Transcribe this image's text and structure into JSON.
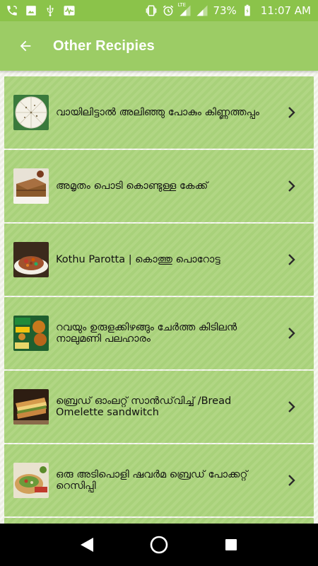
{
  "status_bar": {
    "battery_percent": "73%",
    "time": "11:07 AM",
    "network_label": "LTE",
    "icons": [
      "phone-call-icon",
      "image-icon",
      "usb-icon",
      "activity-icon",
      "vibrate-icon",
      "alarm-icon",
      "signal-icon",
      "signal-icon",
      "battery-icon"
    ]
  },
  "app_bar": {
    "title": "Other Recipies",
    "back_icon": "arrow-back-icon"
  },
  "theme": {
    "status_bar_color": "#8bc34a",
    "app_bar_color": "#9ccc65",
    "card_color": "#a8d17a"
  },
  "recipes": [
    {
      "title": "വായിലിട്ടാൽ അലിഞ്ഞു പോകും കിണ്ണത്തപ്പം",
      "thumb": "kinnathappam-thumbnail"
    },
    {
      "title": "അമൃതം പൊടി കൊണ്ടുള്ള കേക്ക്",
      "thumb": "cake-thumbnail"
    },
    {
      "title": "Kothu Parotta | കൊത്തു പൊറോട്ട",
      "thumb": "kothu-parotta-thumbnail"
    },
    {
      "title": "റവയും ഉരുളക്കിഴങ്ങും ചേർത്ത കിടിലൻ നാലുമണി പലഹാരം",
      "thumb": "rava-snack-thumbnail"
    },
    {
      "title": "ബ്രെഡ് ഓംലറ്റ് സാൻഡ്‌വിച്ച് /Bread Omelette sandwitch",
      "thumb": "sandwich-thumbnail"
    },
    {
      "title": "ഒരു അടിപൊളി ഷവർമ ബ്രെഡ് പോക്കറ്റ് റെസിപ്പി",
      "thumb": "shawarma-pocket-thumbnail"
    }
  ],
  "nav_bar": {
    "buttons": [
      "back-triangle-icon",
      "home-circle-icon",
      "recents-square-icon"
    ]
  }
}
